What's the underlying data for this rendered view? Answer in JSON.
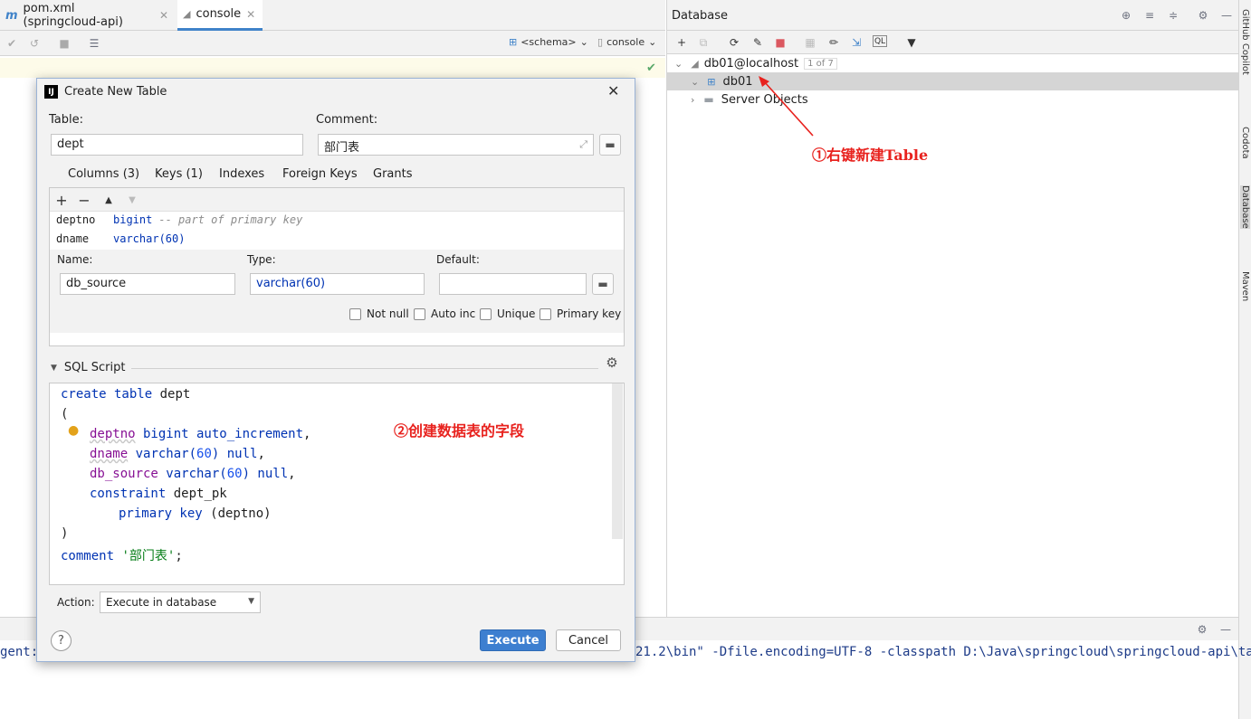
{
  "editor": {
    "tabs": [
      {
        "label": "pom.xml (springcloud-api)",
        "icon": "maven-icon"
      },
      {
        "label": "console",
        "icon": "console-icon"
      }
    ],
    "schema_selector": "<schema>",
    "console_selector": "console"
  },
  "database_panel": {
    "title": "Database",
    "tree": [
      {
        "label": "db01@localhost",
        "badge": "1 of 7"
      },
      {
        "label": "db01"
      },
      {
        "label": "Server Objects"
      }
    ]
  },
  "right_strip": [
    "GitHub Copilot",
    "Codota",
    "Database",
    "Maven"
  ],
  "console_output": {
    "left": "gent:",
    "right": "21.2\\bin\" -Dfile.encoding=UTF-8 -classpath D:\\Java\\springcloud\\springcloud-api\\targe"
  },
  "dialog": {
    "title": "Create New Table",
    "table_label": "Table:",
    "table_value": "dept",
    "comment_label": "Comment:",
    "comment_value": "部门表",
    "tabs": [
      "Columns (3)",
      "Keys (1)",
      "Indexes",
      "Foreign Keys",
      "Grants"
    ],
    "columns": [
      {
        "name": "deptno",
        "type": "bigint",
        "note": "-- part of primary key"
      },
      {
        "name": "dname",
        "type": "varchar(60)",
        "note": ""
      }
    ],
    "editor": {
      "name_label": "Name:",
      "name_value": "db_source",
      "type_label": "Type:",
      "type_value": "varchar(60)",
      "default_label": "Default:",
      "default_value": "",
      "checkboxes": [
        "Not null",
        "Auto inc",
        "Unique",
        "Primary key"
      ]
    },
    "sql_section_label": "SQL Script",
    "sql": {
      "l1a": "create table",
      "l1b": " dept",
      "l2": "(",
      "l3a": "deptno",
      "l3b": " bigint auto_increment",
      "l4a": "dname",
      "l4b": " varchar(",
      "l4c": "60",
      "l4d": ") null",
      "l5a": "db_source",
      "l5b": " varchar(",
      "l5c": "60",
      "l5d": ") null",
      "l6a": "constraint",
      "l6b": " dept_pk",
      "l7a": "primary key",
      "l7b": " (deptno)",
      "l8": ")",
      "l9a": "comment",
      "l9b": "'部门表'"
    },
    "action_label": "Action:",
    "action_value": "Execute in database",
    "execute_label": "Execute",
    "cancel_label": "Cancel",
    "help_label": "?"
  },
  "annotations": {
    "a1": "①右键新建Table",
    "a2": "②创建数据表的字段"
  },
  "colors": {
    "accent": "#4083c9",
    "annotation": "#e8221e",
    "execute": "#3d7fd0"
  }
}
